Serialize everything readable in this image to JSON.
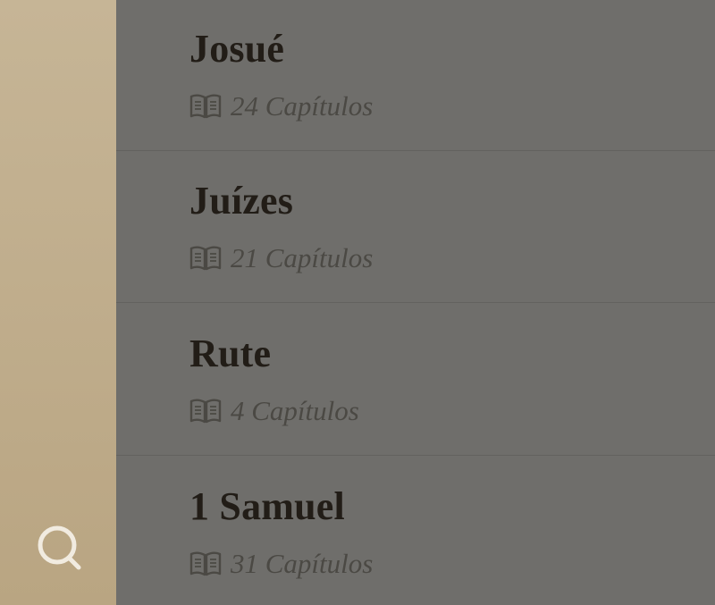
{
  "sidebar": {
    "search_icon": "search-icon",
    "colors": {
      "top": "#c6b596",
      "bottom": "#b9a582",
      "icon": "#f1ebe0"
    }
  },
  "list": {
    "background": "#6f6e6b",
    "chapter_icon": "open-book-icon",
    "books": [
      {
        "name": "Josué",
        "chapters": "24 Capítulos"
      },
      {
        "name": "Juízes",
        "chapters": "21 Capítulos"
      },
      {
        "name": "Rute",
        "chapters": "4 Capítulos"
      },
      {
        "name": "1 Samuel",
        "chapters": "31 Capítulos"
      }
    ]
  }
}
